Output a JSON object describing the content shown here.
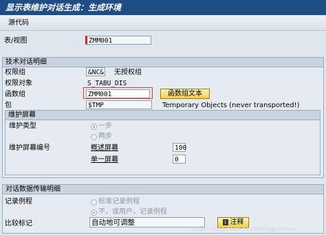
{
  "window": {
    "title": "显示表维护对话生成：生成环境"
  },
  "toolbar": {
    "source_code_label": "源代码"
  },
  "table_view": {
    "label": "表/视图",
    "value": "ZMM001"
  },
  "tech_group": {
    "title": "技术对话明细",
    "auth_group_label": "权限组",
    "auth_group_value": "&NC&",
    "auth_group_desc": "无授权组",
    "auth_object_label": "权限对象",
    "auth_object_value": "S_TABU_DIS",
    "function_group_label": "函数组",
    "function_group_value": "ZMM001",
    "function_group_text_button": "函数组文本",
    "package_label": "包",
    "package_value": "$TMP",
    "package_desc": "Temporary Objects (never transported!)"
  },
  "maint_screen_group": {
    "title": "维护屏幕",
    "type_label": "维护类型",
    "one_step_label": "一步",
    "two_step_label": "两步",
    "screen_number_label": "维护屏幕编号",
    "overview_screen_label": "概述屏幕",
    "overview_screen_value": "100",
    "single_screen_label": "单一屏幕",
    "single_screen_value": "0"
  },
  "transport_group": {
    "title": "对话数据传输明细",
    "record_routine_label": "记录例程",
    "standard_routine_label": "标准记录例程",
    "no_user_routine_label": "不，或用户，记录例程",
    "compare_flag_label": "比较标记",
    "compare_flag_value": "自动地可调整",
    "comment_button": "注释"
  },
  "watermark": "https://blog.csdn.net/zhongguomao"
}
